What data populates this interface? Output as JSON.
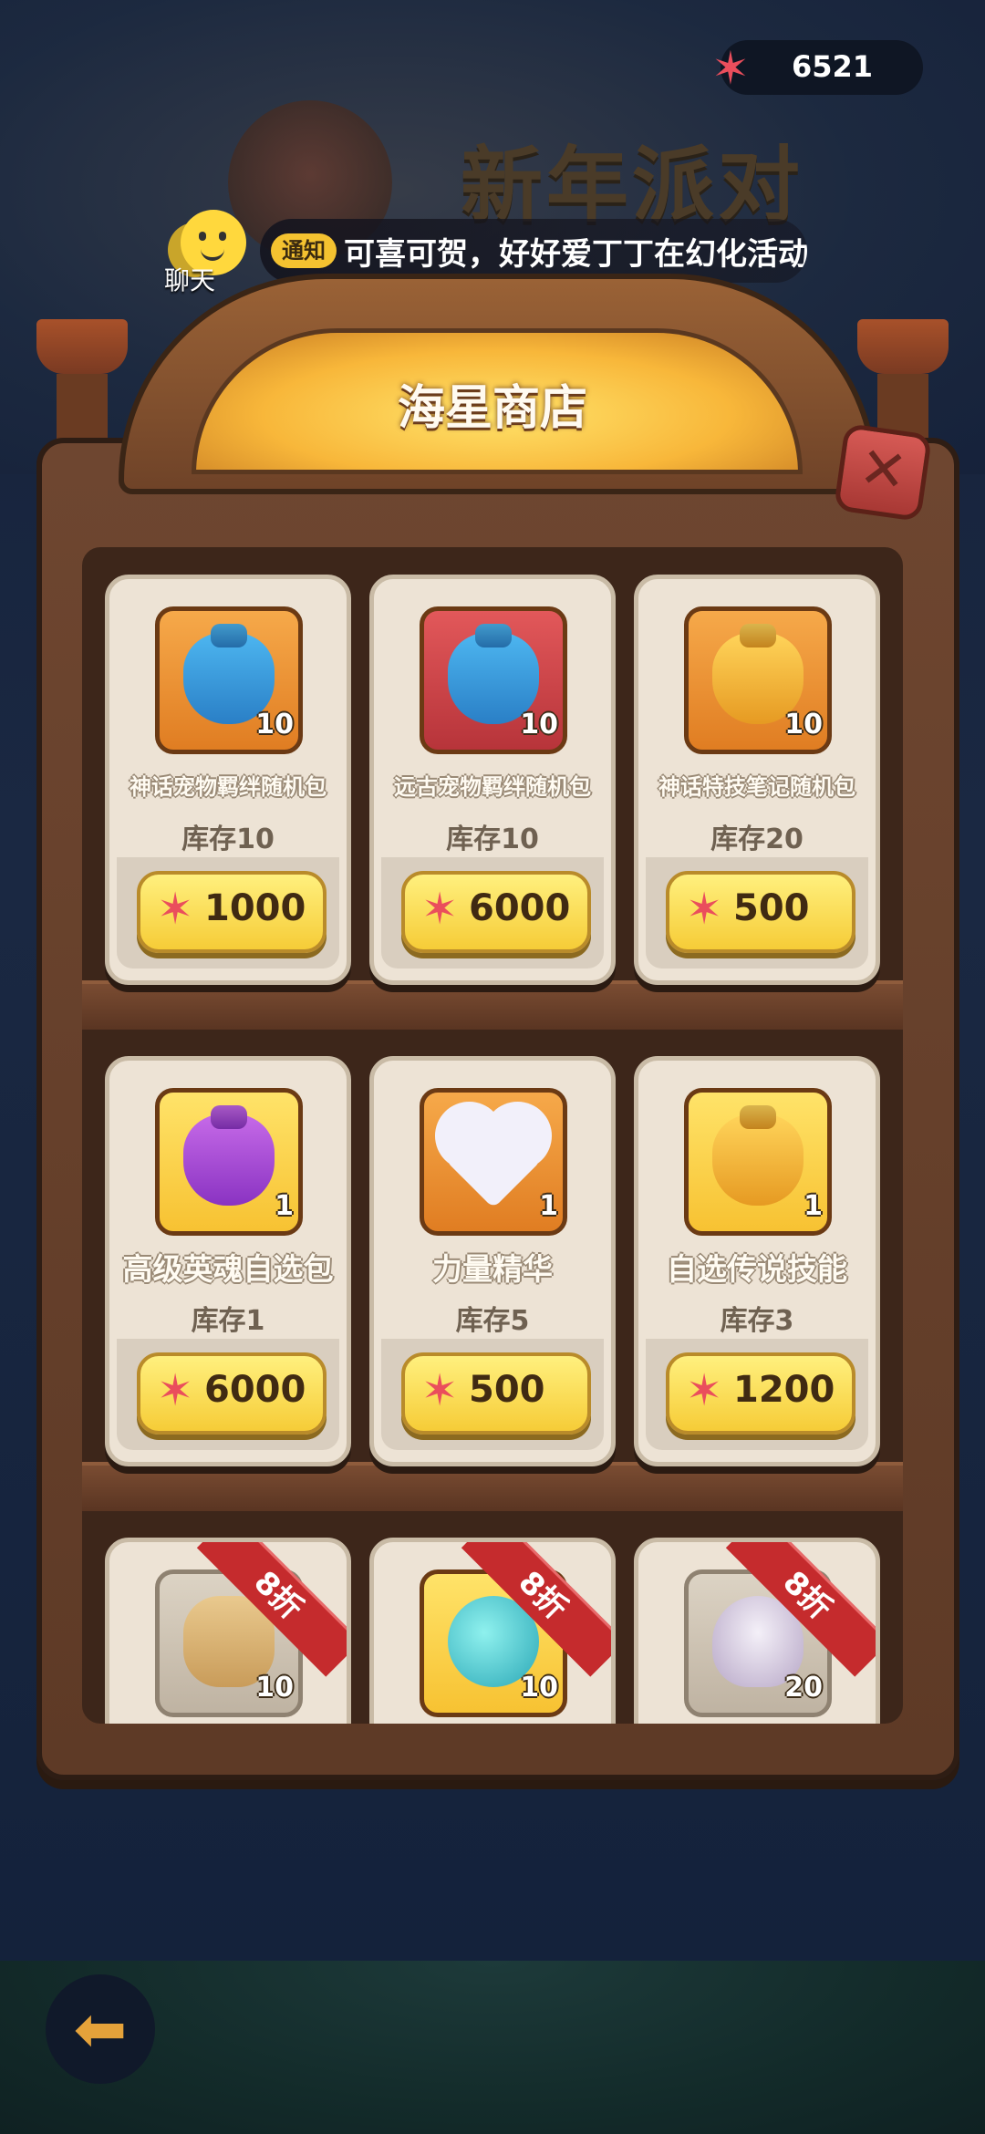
{
  "header": {
    "event_title": "新年派对",
    "currency_amount": "6521",
    "currency_icon": "starfish-icon"
  },
  "chat": {
    "label": "聊天"
  },
  "notice": {
    "tag": "通知",
    "message": "可喜可贺，好好爱丁丁在幻化活动"
  },
  "shop": {
    "title": "海星商店"
  },
  "items": [
    {
      "name": "神话宠物羁绊随机包",
      "qty": "10",
      "stock": "库存10",
      "price": "1000",
      "icon": "blue-bag-icon",
      "frame": "orange"
    },
    {
      "name": "远古宠物羁绊随机包",
      "qty": "10",
      "stock": "库存10",
      "price": "6000",
      "icon": "blue-bag-icon",
      "frame": "red"
    },
    {
      "name": "神话特技笔记随机包",
      "qty": "10",
      "stock": "库存20",
      "price": "500",
      "icon": "gold-bag-icon",
      "frame": "orange"
    },
    {
      "name": "高级英魂自选包",
      "qty": "1",
      "stock": "库存1",
      "price": "6000",
      "icon": "purple-bag-icon",
      "frame": "yellow"
    },
    {
      "name": "力量精华",
      "qty": "1",
      "stock": "库存5",
      "price": "500",
      "icon": "crystal-heart-icon",
      "frame": "orange"
    },
    {
      "name": "自选传说技能",
      "qty": "1",
      "stock": "库存3",
      "price": "1200",
      "icon": "gold-bag-icon",
      "frame": "yellow"
    },
    {
      "qty": "10",
      "discount": "8折",
      "icon": "scroll-icon",
      "frame": "grey"
    },
    {
      "qty": "10",
      "discount": "8折",
      "icon": "potion-bottle-icon",
      "frame": "yellow"
    },
    {
      "qty": "20",
      "discount": "8折",
      "icon": "shell-icon",
      "frame": "grey"
    }
  ],
  "colors": {
    "background": "#15213a",
    "board": "#6e4630",
    "price_button": "#f6cc37",
    "discount_ribbon": "#c52b2d",
    "star_currency": "#ea4e5c"
  }
}
